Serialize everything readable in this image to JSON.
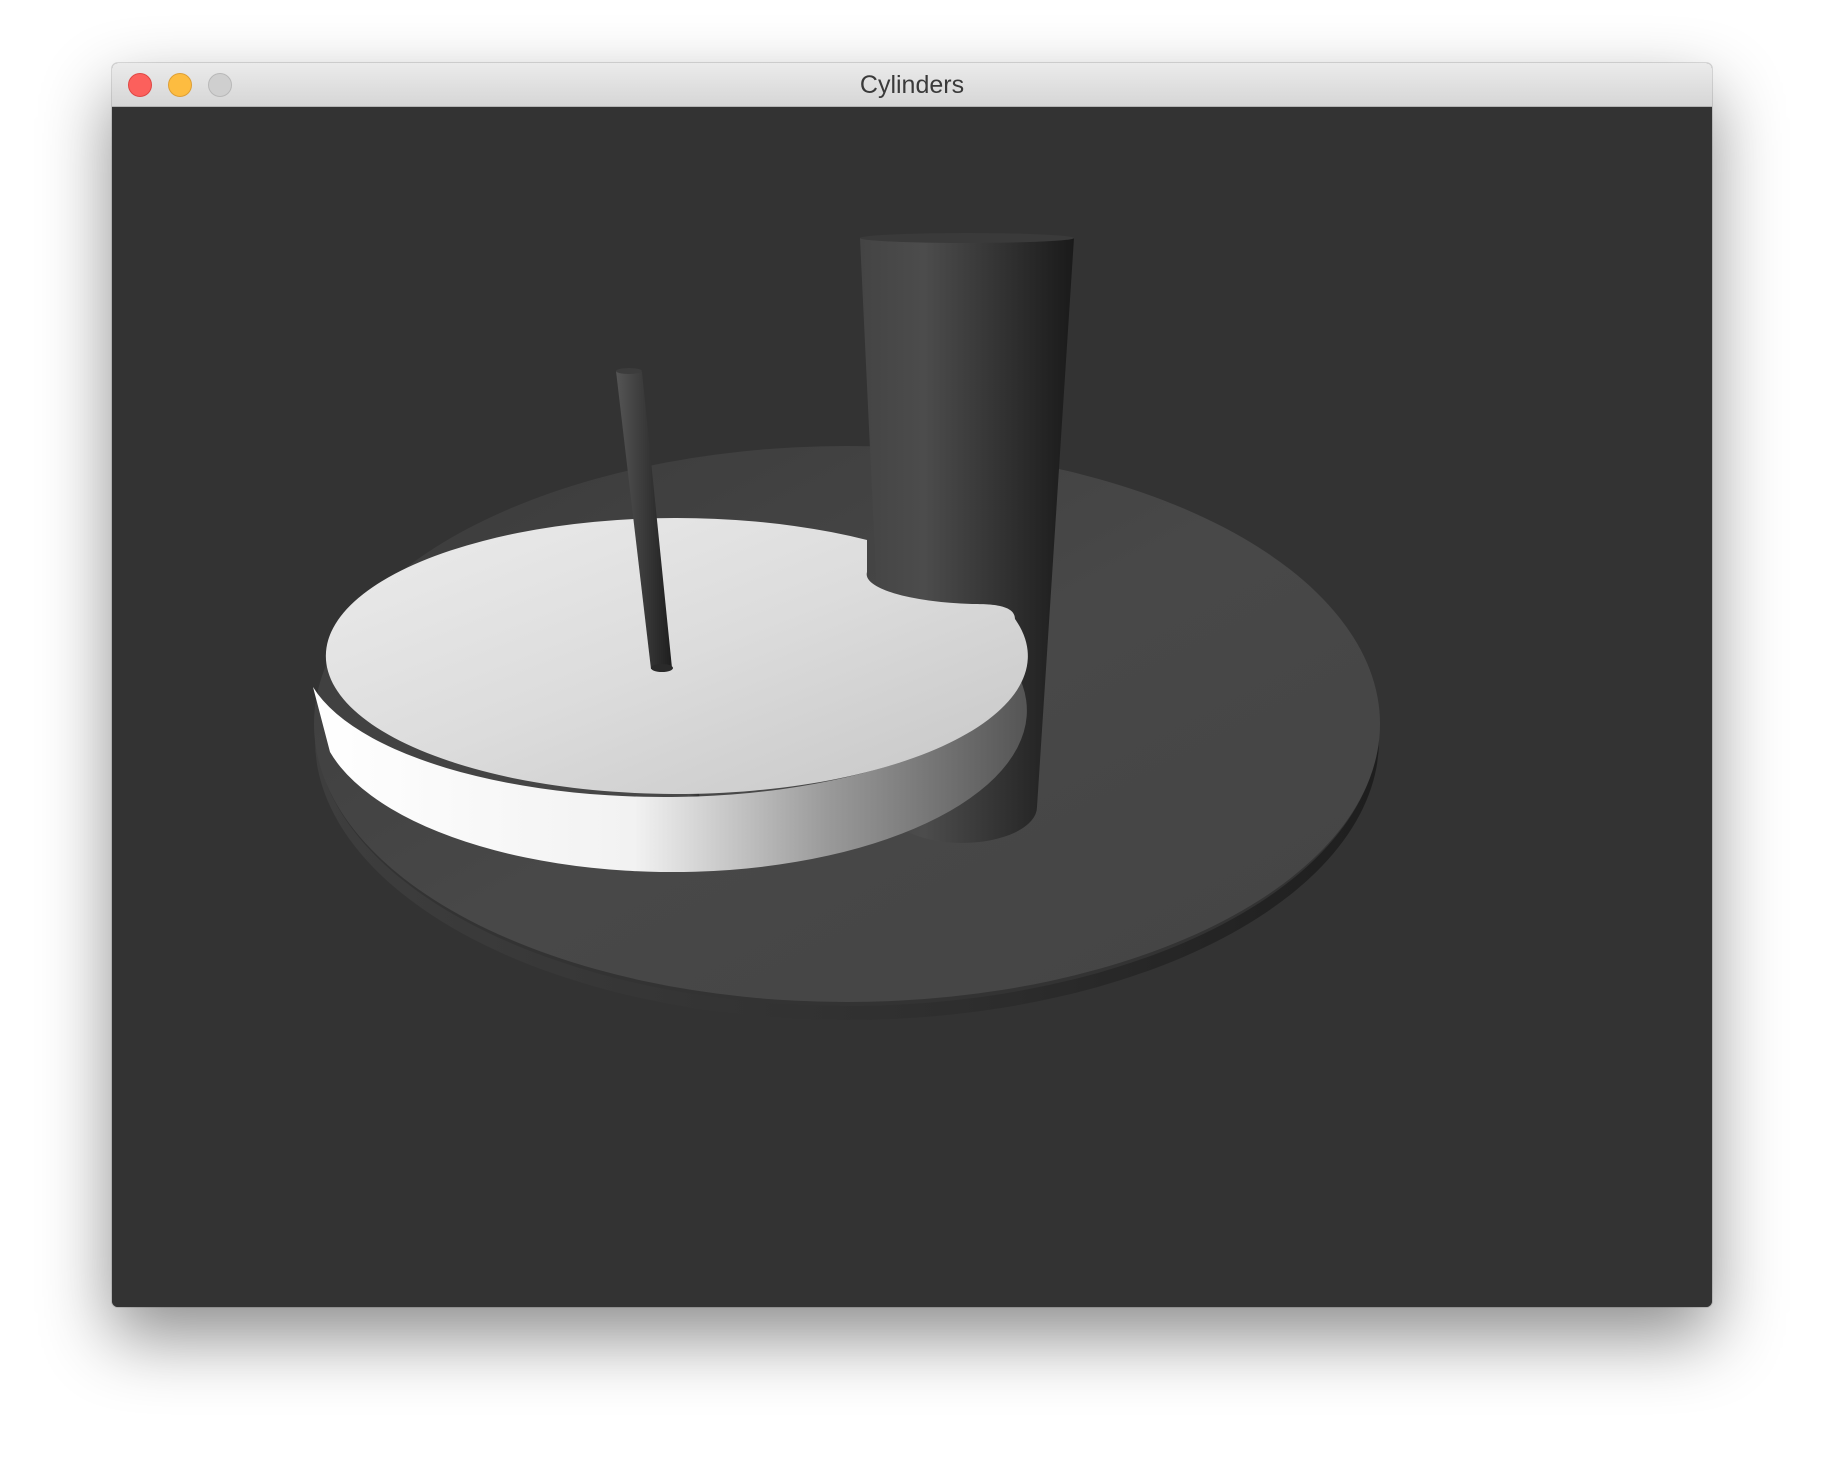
{
  "window": {
    "title": "Cylinders",
    "controls": [
      "close",
      "minimize",
      "zoom"
    ]
  },
  "scene": {
    "background": "#333333",
    "objects": [
      "large-base-disc",
      "white-disc",
      "tall-cylinder",
      "thin-rod"
    ]
  }
}
